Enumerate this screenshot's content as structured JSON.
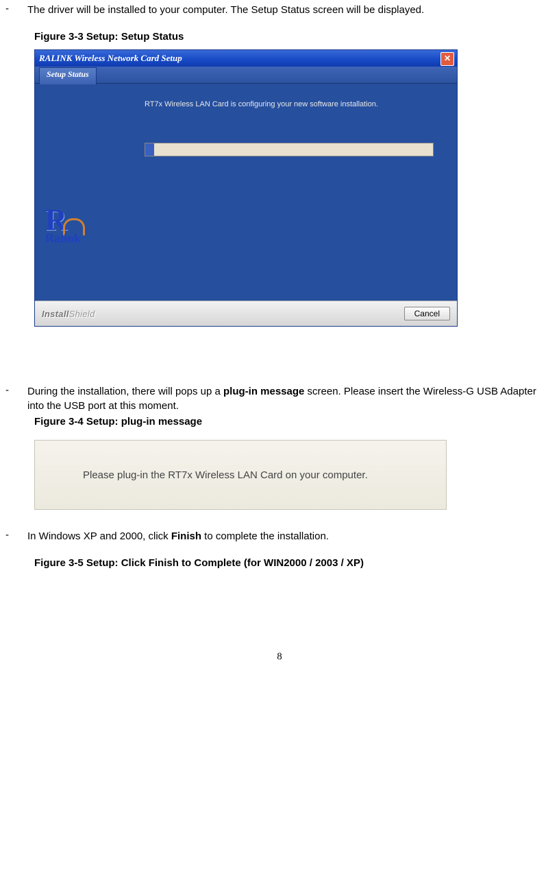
{
  "doc": {
    "bullet1": "The driver will be installed to your computer. The Setup Status screen will be displayed.",
    "fig33_prefix": "Figure 3-3 ",
    "fig33_title": "Setup: Setup Status",
    "bullet2_a": "During the installation, there will pops up a ",
    "bullet2_bold": "plug-in message",
    "bullet2_b": " screen. Please insert the Wireless-G USB Adapter into the USB port at this moment.",
    "fig34_prefix": "Figure 3-4 ",
    "fig34_title": "Setup: plug-in message",
    "bullet3_a": "In Windows XP and 2000, click ",
    "bullet3_bold": "Finish",
    "bullet3_b": " to complete the installation.",
    "fig35_prefix": "Figure 3-5 ",
    "fig35_title": "Setup: Click Finish to Complete (for WIN2000 / 2003 / XP)",
    "page_number": "8"
  },
  "installer": {
    "window_title": "RALINK Wireless Network Card Setup",
    "tab_label": "Setup Status",
    "message": "RT7x Wireless LAN Card is configuring your new software installation.",
    "brand": "Ralink",
    "installshield_bold": "Install",
    "installshield_light": "Shield",
    "cancel_label": "Cancel",
    "close_glyph": "✕"
  },
  "plugin_dialog": {
    "text": "Please plug-in the RT7x Wireless LAN Card on your computer."
  }
}
